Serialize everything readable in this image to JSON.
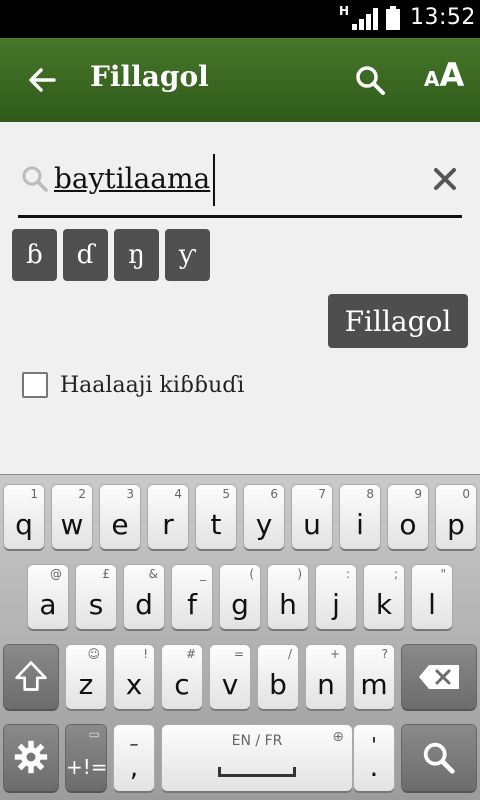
{
  "status_bar": {
    "network_type": "H",
    "time": "13:52"
  },
  "action_bar": {
    "title": "Fillagol",
    "font_icon_small": "A",
    "font_icon_big": "A"
  },
  "search": {
    "value": "baytilaama"
  },
  "special_chars": [
    "ɓ",
    "ɗ",
    "ŋ",
    "ƴ"
  ],
  "submit_label": "Fillagol",
  "checkbox": {
    "label": "Haalaaji kiɓɓuɗi",
    "checked": false
  },
  "keyboard": {
    "row1": [
      {
        "hint": "1",
        "main": "q"
      },
      {
        "hint": "2",
        "main": "w"
      },
      {
        "hint": "3",
        "main": "e"
      },
      {
        "hint": "4",
        "main": "r"
      },
      {
        "hint": "5",
        "main": "t"
      },
      {
        "hint": "6",
        "main": "y"
      },
      {
        "hint": "7",
        "main": "u"
      },
      {
        "hint": "8",
        "main": "i"
      },
      {
        "hint": "9",
        "main": "o"
      },
      {
        "hint": "0",
        "main": "p"
      }
    ],
    "row2": [
      {
        "hint": "@",
        "main": "a"
      },
      {
        "hint": "£",
        "main": "s"
      },
      {
        "hint": "&",
        "main": "d"
      },
      {
        "hint": "_",
        "main": "f"
      },
      {
        "hint": "(",
        "main": "g"
      },
      {
        "hint": ")",
        "main": "h"
      },
      {
        "hint": ":",
        "main": "j"
      },
      {
        "hint": ";",
        "main": "k"
      },
      {
        "hint": "\"",
        "main": "l"
      }
    ],
    "row3": [
      {
        "hint": "☺",
        "main": "z"
      },
      {
        "hint": "!",
        "main": "x"
      },
      {
        "hint": "#",
        "main": "c"
      },
      {
        "hint": "=",
        "main": "v"
      },
      {
        "hint": "/",
        "main": "b"
      },
      {
        "hint": "+",
        "main": "n"
      },
      {
        "hint": "?",
        "main": "m"
      }
    ],
    "symbols_label": "+!=",
    "comma_hint": "–",
    "comma_label": ",",
    "space_label": "EN / FR",
    "period_hint": "'",
    "period_label": "."
  }
}
